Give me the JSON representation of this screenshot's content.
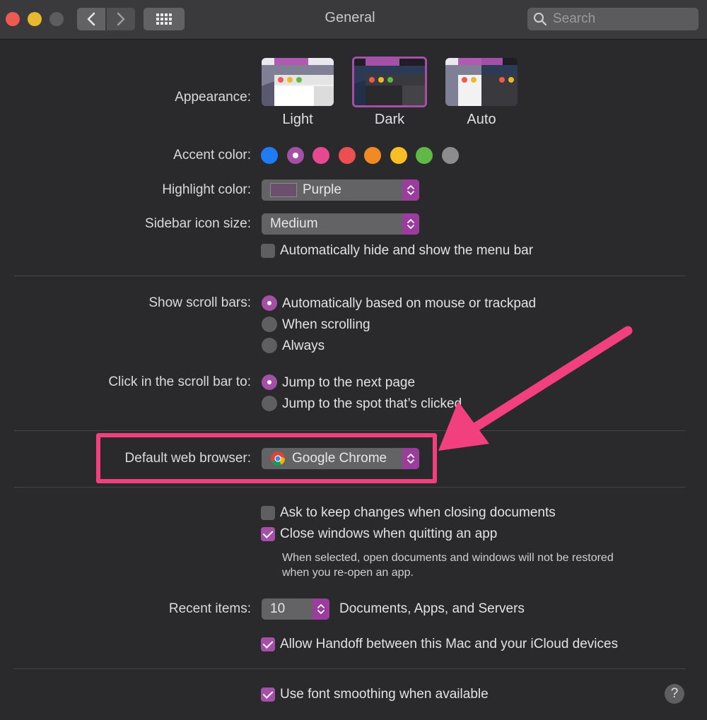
{
  "window": {
    "title": "General",
    "search_placeholder": "Search"
  },
  "appearance": {
    "label": "Appearance:",
    "options": [
      "Light",
      "Dark",
      "Auto"
    ],
    "selected": "Dark"
  },
  "accent": {
    "label": "Accent color:",
    "colors": [
      "#1f7cf4",
      "#a550a7",
      "#e6498f",
      "#ec4f52",
      "#f08a24",
      "#f7bf25",
      "#5fb944",
      "#8c8c8c"
    ],
    "selected_index": 1
  },
  "highlight": {
    "label": "Highlight color:",
    "value": "Purple",
    "swatch": "#6b4f6c"
  },
  "sidebar_icon": {
    "label": "Sidebar icon size:",
    "value": "Medium"
  },
  "menubar": {
    "label": "Automatically hide and show the menu bar",
    "checked": false
  },
  "scroll_bars": {
    "label": "Show scroll bars:",
    "options": [
      "Automatically based on mouse or trackpad",
      "When scrolling",
      "Always"
    ],
    "selected_index": 0
  },
  "click_scroll": {
    "label": "Click in the scroll bar to:",
    "options": [
      "Jump to the next page",
      "Jump to the spot that’s clicked"
    ],
    "selected_index": 0
  },
  "browser": {
    "label": "Default web browser:",
    "value": "Google Chrome"
  },
  "documents": {
    "ask_keep": "Ask to keep changes when closing documents",
    "ask_keep_checked": false,
    "close_windows": "Close windows when quitting an app",
    "close_windows_checked": true,
    "hint_line1": "When selected, open documents and windows will not be restored",
    "hint_line2": "when you re-open an app."
  },
  "recent": {
    "label": "Recent items:",
    "value": "10",
    "suffix": "Documents, Apps, and Servers"
  },
  "handoff": {
    "label": "Allow Handoff between this Mac and your iCloud devices",
    "checked": true
  },
  "smoothing": {
    "label": "Use font smoothing when available",
    "checked": true
  },
  "help": {
    "glyph": "?"
  },
  "colors": {
    "accent": "#a550a7",
    "annotation": "#f23f7e"
  }
}
